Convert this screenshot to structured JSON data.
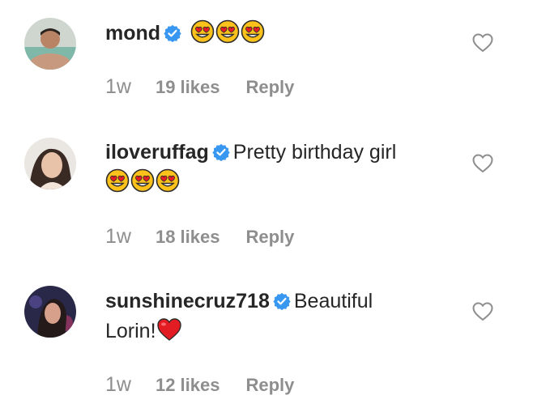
{
  "comments": [
    {
      "username": "mond",
      "verified": true,
      "text": "",
      "emojis": [
        "heart-eyes",
        "heart-eyes",
        "heart-eyes"
      ],
      "time": "1w",
      "likes": "19 likes",
      "reply": "Reply"
    },
    {
      "username": "iloveruffag",
      "verified": true,
      "text": "Pretty birthday girl",
      "emojis": [
        "heart-eyes",
        "heart-eyes",
        "heart-eyes"
      ],
      "time": "1w",
      "likes": "18 likes",
      "reply": "Reply"
    },
    {
      "username": "sunshinecruz718",
      "verified": true,
      "text_line1": "Beautiful",
      "text_line2": "Lorin!",
      "emojis": [
        "red-heart"
      ],
      "time": "1w",
      "likes": "12 likes",
      "reply": "Reply"
    }
  ],
  "colors": {
    "text": "#262626",
    "muted": "#8e8e8e",
    "verified": "#3897f0"
  }
}
